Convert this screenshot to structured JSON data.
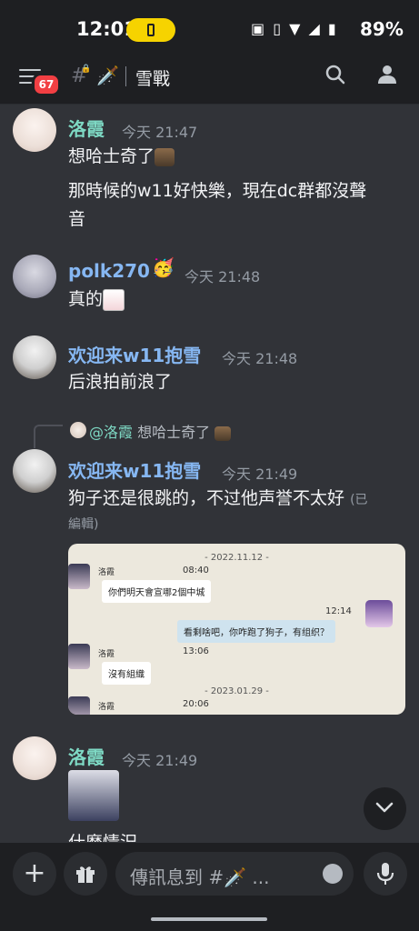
{
  "status_bar": {
    "time": "12:01",
    "battery": "89%"
  },
  "header": {
    "badge": "67",
    "channel_emoji": "🗡️",
    "channel_name": "雪戰"
  },
  "messages": [
    {
      "author": "洛霞",
      "time": "今天 21:47",
      "lines": [
        "想哈士奇了",
        "那時候的w11好快樂，現在dc群都沒聲",
        "音"
      ]
    },
    {
      "author": "polk270",
      "time": "今天 21:48",
      "lines": [
        "真的"
      ]
    },
    {
      "author": "欢迎来w11抱雪",
      "time": "今天 21:48",
      "lines": [
        "后浪拍前浪了"
      ]
    },
    {
      "author": "欢迎来w11抱雪",
      "time": "今天 21:49",
      "reply": {
        "mention": "@洛霞",
        "text": "想哈士奇了"
      },
      "lines": [
        "狗子还是很跳的，不过他声誉不太好"
      ],
      "edited": "(已",
      "edited2": "編輯)"
    },
    {
      "author": "洛霞",
      "time": "今天 21:49",
      "lines": [
        "什麼情況"
      ]
    }
  ],
  "embed": {
    "date1": "-    2022.11.12    -",
    "name": "洛霞",
    "time1": "08:40",
    "bubble1": "你們明天會宣哪2個中城",
    "time2": "12:14",
    "bubble2": "看剩啥吧，你咋跑了狗子，有组织？",
    "time3": "13:06",
    "bubble3": "沒有組織",
    "date2": "-    2023.01.29    -",
    "time4": "20:06"
  },
  "composer": {
    "placeholder": "傳訊息到 #🗡️ ..."
  }
}
